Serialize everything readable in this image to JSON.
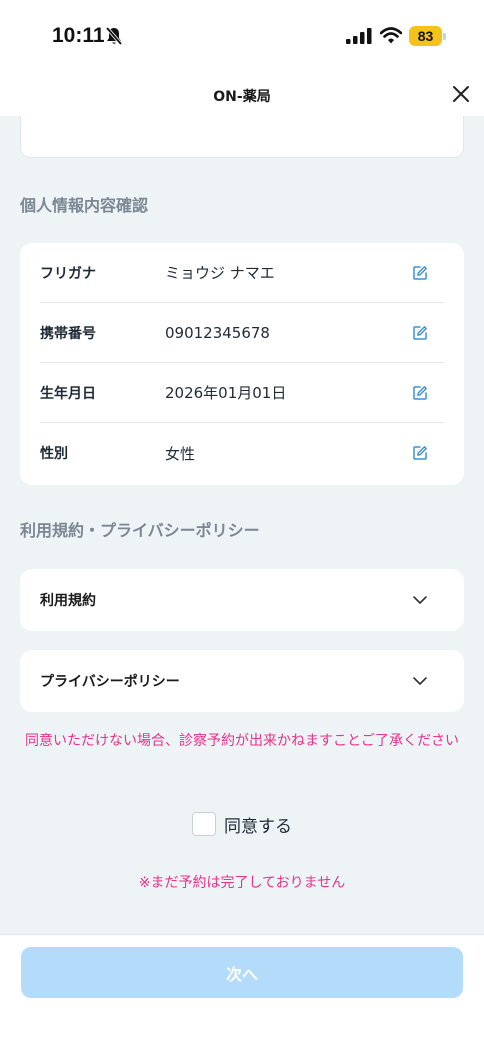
{
  "status_bar": {
    "time": "10:11",
    "battery": "83"
  },
  "nav": {
    "title": "ON-薬局"
  },
  "personal_info": {
    "section_title": "個人情報内容確認",
    "rows": [
      {
        "label": "フリガナ",
        "value": "ミョウジ ナマエ"
      },
      {
        "label": "携帯番号",
        "value": "09012345678"
      },
      {
        "label": "生年月日",
        "value": "2026年01月01日"
      },
      {
        "label": "性別",
        "value": "女性"
      }
    ]
  },
  "policies": {
    "section_title": "利用規約・プライバシーポリシー",
    "terms_label": "利用規約",
    "privacy_label": "プライバシーポリシー"
  },
  "notice_text": "同意いただけない場合、診察予約が出来かねますことご了承ください",
  "agree_label": "同意する",
  "warning_text": "※まだ予約は完了しておりません",
  "next_label": "次へ",
  "colors": {
    "accent_pink": "#e6338c",
    "button_disabled": "#b3dcfa",
    "icon_blue": "#3d8fd6",
    "background": "#eef3f6"
  }
}
